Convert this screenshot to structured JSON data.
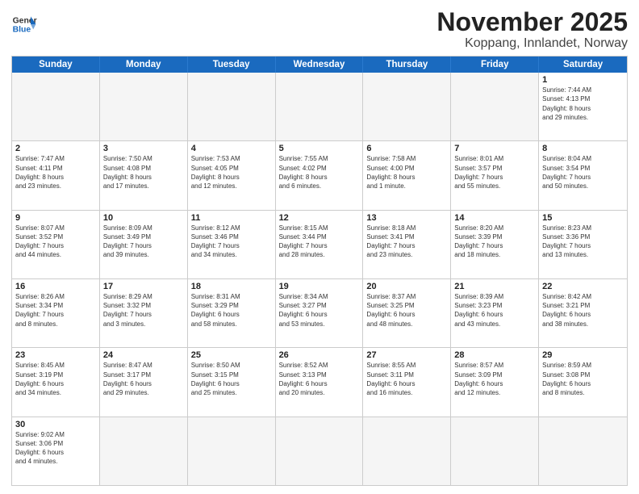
{
  "logo": {
    "text_general": "General",
    "text_blue": "Blue"
  },
  "title": "November 2025",
  "subtitle": "Koppang, Innlandet, Norway",
  "days_of_week": [
    "Sunday",
    "Monday",
    "Tuesday",
    "Wednesday",
    "Thursday",
    "Friday",
    "Saturday"
  ],
  "weeks": [
    [
      {
        "day": "",
        "info": "",
        "empty": true
      },
      {
        "day": "",
        "info": "",
        "empty": true
      },
      {
        "day": "",
        "info": "",
        "empty": true
      },
      {
        "day": "",
        "info": "",
        "empty": true
      },
      {
        "day": "",
        "info": "",
        "empty": true
      },
      {
        "day": "",
        "info": "",
        "empty": true
      },
      {
        "day": "1",
        "info": "Sunrise: 7:44 AM\nSunset: 4:13 PM\nDaylight: 8 hours\nand 29 minutes.",
        "empty": false
      }
    ],
    [
      {
        "day": "2",
        "info": "Sunrise: 7:47 AM\nSunset: 4:11 PM\nDaylight: 8 hours\nand 23 minutes.",
        "empty": false
      },
      {
        "day": "3",
        "info": "Sunrise: 7:50 AM\nSunset: 4:08 PM\nDaylight: 8 hours\nand 17 minutes.",
        "empty": false
      },
      {
        "day": "4",
        "info": "Sunrise: 7:53 AM\nSunset: 4:05 PM\nDaylight: 8 hours\nand 12 minutes.",
        "empty": false
      },
      {
        "day": "5",
        "info": "Sunrise: 7:55 AM\nSunset: 4:02 PM\nDaylight: 8 hours\nand 6 minutes.",
        "empty": false
      },
      {
        "day": "6",
        "info": "Sunrise: 7:58 AM\nSunset: 4:00 PM\nDaylight: 8 hours\nand 1 minute.",
        "empty": false
      },
      {
        "day": "7",
        "info": "Sunrise: 8:01 AM\nSunset: 3:57 PM\nDaylight: 7 hours\nand 55 minutes.",
        "empty": false
      },
      {
        "day": "8",
        "info": "Sunrise: 8:04 AM\nSunset: 3:54 PM\nDaylight: 7 hours\nand 50 minutes.",
        "empty": false
      }
    ],
    [
      {
        "day": "9",
        "info": "Sunrise: 8:07 AM\nSunset: 3:52 PM\nDaylight: 7 hours\nand 44 minutes.",
        "empty": false
      },
      {
        "day": "10",
        "info": "Sunrise: 8:09 AM\nSunset: 3:49 PM\nDaylight: 7 hours\nand 39 minutes.",
        "empty": false
      },
      {
        "day": "11",
        "info": "Sunrise: 8:12 AM\nSunset: 3:46 PM\nDaylight: 7 hours\nand 34 minutes.",
        "empty": false
      },
      {
        "day": "12",
        "info": "Sunrise: 8:15 AM\nSunset: 3:44 PM\nDaylight: 7 hours\nand 28 minutes.",
        "empty": false
      },
      {
        "day": "13",
        "info": "Sunrise: 8:18 AM\nSunset: 3:41 PM\nDaylight: 7 hours\nand 23 minutes.",
        "empty": false
      },
      {
        "day": "14",
        "info": "Sunrise: 8:20 AM\nSunset: 3:39 PM\nDaylight: 7 hours\nand 18 minutes.",
        "empty": false
      },
      {
        "day": "15",
        "info": "Sunrise: 8:23 AM\nSunset: 3:36 PM\nDaylight: 7 hours\nand 13 minutes.",
        "empty": false
      }
    ],
    [
      {
        "day": "16",
        "info": "Sunrise: 8:26 AM\nSunset: 3:34 PM\nDaylight: 7 hours\nand 8 minutes.",
        "empty": false
      },
      {
        "day": "17",
        "info": "Sunrise: 8:29 AM\nSunset: 3:32 PM\nDaylight: 7 hours\nand 3 minutes.",
        "empty": false
      },
      {
        "day": "18",
        "info": "Sunrise: 8:31 AM\nSunset: 3:29 PM\nDaylight: 6 hours\nand 58 minutes.",
        "empty": false
      },
      {
        "day": "19",
        "info": "Sunrise: 8:34 AM\nSunset: 3:27 PM\nDaylight: 6 hours\nand 53 minutes.",
        "empty": false
      },
      {
        "day": "20",
        "info": "Sunrise: 8:37 AM\nSunset: 3:25 PM\nDaylight: 6 hours\nand 48 minutes.",
        "empty": false
      },
      {
        "day": "21",
        "info": "Sunrise: 8:39 AM\nSunset: 3:23 PM\nDaylight: 6 hours\nand 43 minutes.",
        "empty": false
      },
      {
        "day": "22",
        "info": "Sunrise: 8:42 AM\nSunset: 3:21 PM\nDaylight: 6 hours\nand 38 minutes.",
        "empty": false
      }
    ],
    [
      {
        "day": "23",
        "info": "Sunrise: 8:45 AM\nSunset: 3:19 PM\nDaylight: 6 hours\nand 34 minutes.",
        "empty": false
      },
      {
        "day": "24",
        "info": "Sunrise: 8:47 AM\nSunset: 3:17 PM\nDaylight: 6 hours\nand 29 minutes.",
        "empty": false
      },
      {
        "day": "25",
        "info": "Sunrise: 8:50 AM\nSunset: 3:15 PM\nDaylight: 6 hours\nand 25 minutes.",
        "empty": false
      },
      {
        "day": "26",
        "info": "Sunrise: 8:52 AM\nSunset: 3:13 PM\nDaylight: 6 hours\nand 20 minutes.",
        "empty": false
      },
      {
        "day": "27",
        "info": "Sunrise: 8:55 AM\nSunset: 3:11 PM\nDaylight: 6 hours\nand 16 minutes.",
        "empty": false
      },
      {
        "day": "28",
        "info": "Sunrise: 8:57 AM\nSunset: 3:09 PM\nDaylight: 6 hours\nand 12 minutes.",
        "empty": false
      },
      {
        "day": "29",
        "info": "Sunrise: 8:59 AM\nSunset: 3:08 PM\nDaylight: 6 hours\nand 8 minutes.",
        "empty": false
      }
    ],
    [
      {
        "day": "30",
        "info": "Sunrise: 9:02 AM\nSunset: 3:06 PM\nDaylight: 6 hours\nand 4 minutes.",
        "empty": false
      },
      {
        "day": "",
        "info": "",
        "empty": true
      },
      {
        "day": "",
        "info": "",
        "empty": true
      },
      {
        "day": "",
        "info": "",
        "empty": true
      },
      {
        "day": "",
        "info": "",
        "empty": true
      },
      {
        "day": "",
        "info": "",
        "empty": true
      },
      {
        "day": "",
        "info": "",
        "empty": true
      }
    ]
  ]
}
